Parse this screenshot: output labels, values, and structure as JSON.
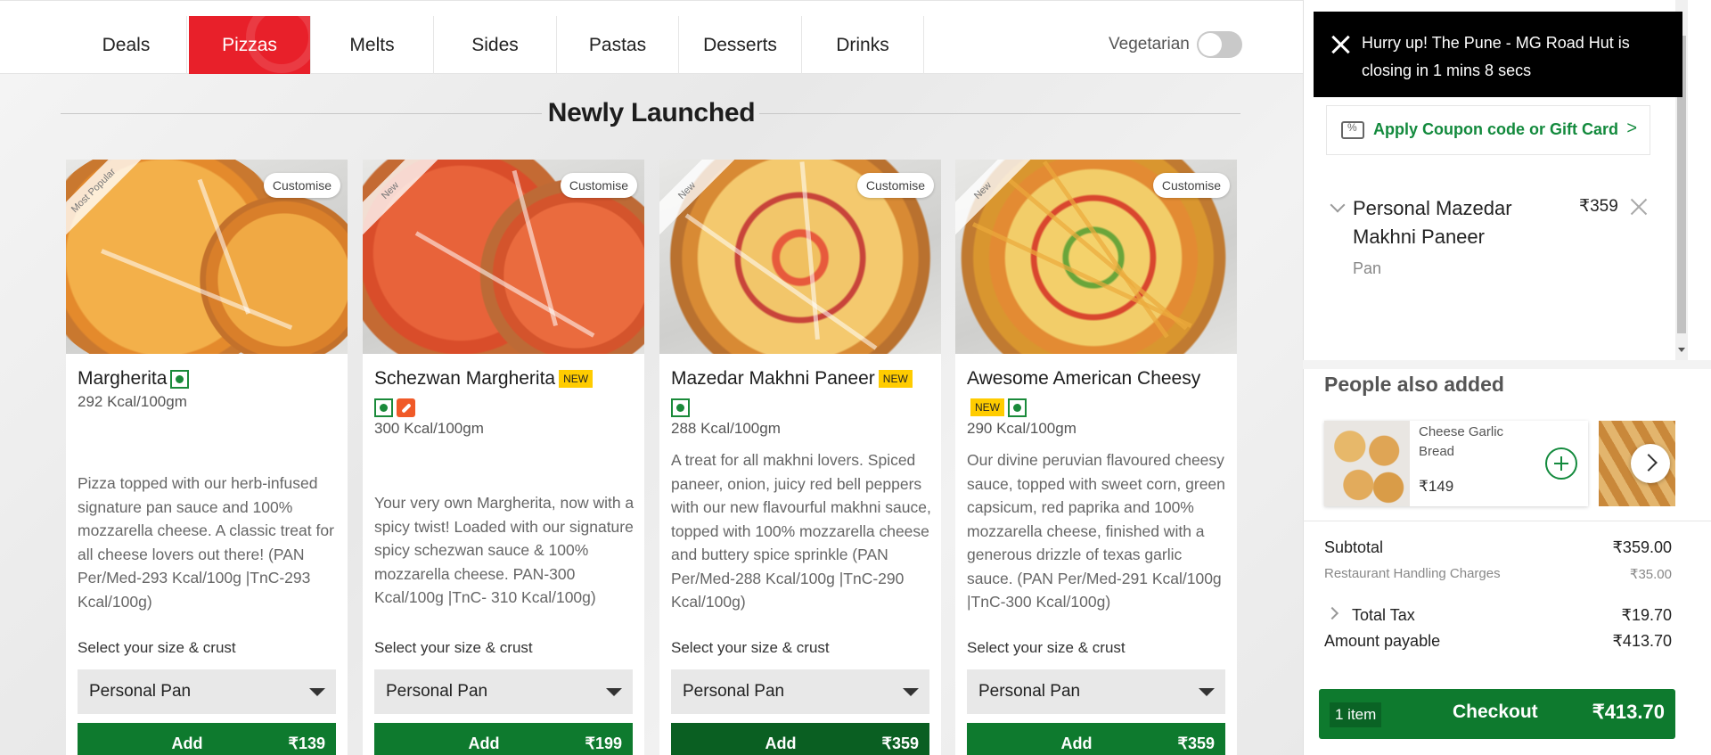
{
  "nav": {
    "tabs": [
      {
        "label": "Deals"
      },
      {
        "label": "Pizzas"
      },
      {
        "label": "Melts"
      },
      {
        "label": "Sides"
      },
      {
        "label": "Pastas"
      },
      {
        "label": "Desserts"
      },
      {
        "label": "Drinks"
      }
    ],
    "active_tab": "Pizzas",
    "vegetarian_label": "Vegetarian",
    "vegetarian_on": false
  },
  "section": {
    "title": "Newly Launched"
  },
  "products": [
    {
      "ribbon": "Most Popular",
      "customise": "Customise",
      "name": "Margherita",
      "new_badge": "",
      "kcal": "292 Kcal/100gm",
      "description": "Pizza topped with our herb-infused signature pan sauce and 100% mozzarella cheese. A classic treat for all cheese lovers out there! (PAN Per/Med-293 Kcal/100g |TnC-293 Kcal/100g)",
      "size_label": "Select your size & crust",
      "size_value": "Personal Pan",
      "add_label": "Add",
      "price": "₹139"
    },
    {
      "ribbon": "New",
      "customise": "Customise",
      "name": "Schezwan Margherita",
      "new_badge": "NEW",
      "kcal": "300 Kcal/100gm",
      "description": "Your very own Margherita, now with a spicy twist! Loaded with our signature spicy schezwan sauce & 100% mozzarella cheese. PAN-300 Kcal/100g |TnC- 310 Kcal/100g)",
      "size_label": "Select your size & crust",
      "size_value": "Personal Pan",
      "add_label": "Add",
      "price": "₹199"
    },
    {
      "ribbon": "New",
      "customise": "Customise",
      "name": "Mazedar Makhni Paneer",
      "new_badge": "NEW",
      "kcal": "288 Kcal/100gm",
      "description": "A treat for all makhni lovers. Spiced paneer, onion, juicy red bell peppers with our new flavourful makhni sauce, topped with 100% mozzarella cheese and buttery spice sprinkle (PAN Per/Med-288 Kcal/100g |TnC-290 Kcal/100g)",
      "size_label": "Select your size & crust",
      "size_value": "Personal Pan",
      "add_label": "Add",
      "price": "₹359"
    },
    {
      "ribbon": "New",
      "customise": "Customise",
      "name": "Awesome American Cheesy",
      "new_badge": "NEW",
      "kcal": "290 Kcal/100gm",
      "description": "Our divine peruvian flavoured cheesy sauce, topped with sweet corn, green capsicum, red paprika and 100% mozzarella cheese, finished with a generous drizzle of texas garlic sauce. (PAN Per/Med-291 Kcal/100g |TnC-300 Kcal/100g)",
      "size_label": "Select your size & crust",
      "size_value": "Personal Pan",
      "add_label": "Add",
      "price": "₹359"
    }
  ],
  "toast": {
    "message": "Hurry up! The Pune - MG Road Hut is closing in 1 mins 8 secs"
  },
  "cart": {
    "coupon_label": "Apply Coupon code or Gift Card",
    "coupon_arrow": ">",
    "item": {
      "name": "Personal Mazedar Makhni Paneer",
      "price": "₹359",
      "crust": "Pan"
    },
    "also_added_title": "People also added",
    "suggestion": {
      "name": "Cheese Garlic Bread",
      "price": "₹149"
    },
    "subtotal_label": "Subtotal",
    "subtotal_value": "₹359.00",
    "handling_label": "Restaurant Handling Charges",
    "handling_value": "₹35.00",
    "tax_label": "Total Tax",
    "tax_value": "₹19.70",
    "payable_label": "Amount payable",
    "payable_value": "₹413.70",
    "checkout_count": "1 item",
    "checkout_label": "Checkout",
    "checkout_total": "₹413.70"
  },
  "colors": {
    "brand_red": "#e8202a",
    "brand_green": "#0e7a2e",
    "badge_yellow": "#ffcc00"
  }
}
